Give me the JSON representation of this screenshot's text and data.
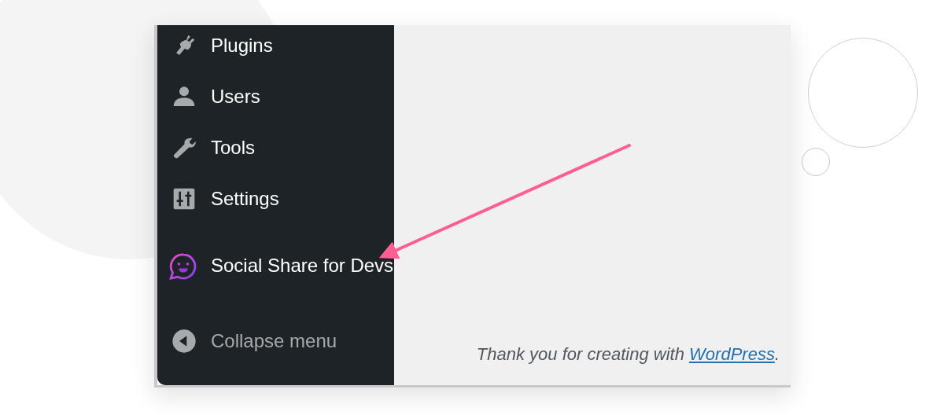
{
  "sidebar": {
    "items": [
      {
        "label": "Plugins"
      },
      {
        "label": "Users"
      },
      {
        "label": "Tools"
      },
      {
        "label": "Settings"
      },
      {
        "label": "Social Share for Devs"
      }
    ],
    "collapse": {
      "label": "Collapse menu"
    }
  },
  "footer": {
    "text": "Thank you for creating with ",
    "link": "WordPress",
    "after": "."
  }
}
